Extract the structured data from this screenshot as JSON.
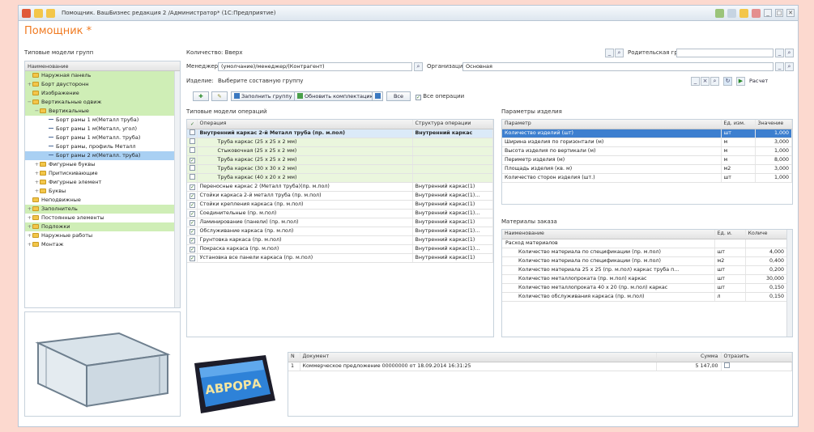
{
  "window": {
    "title": "Помощник. ВашБизнес редакция 2 /Администратор* (1С:Предприятие)",
    "page_title": "Помощник *",
    "controls": [
      "_",
      "□",
      "✕"
    ]
  },
  "left": {
    "filter_label": "Типовые модели групп",
    "tree_header": "Наименование",
    "tree": [
      {
        "label": "Наружная панель",
        "level": 1,
        "kind": "folder",
        "style": "green"
      },
      {
        "label": "Борт двусторонн",
        "level": 1,
        "kind": "folder",
        "style": "green",
        "toggle": "+"
      },
      {
        "label": "Изображение",
        "level": 1,
        "kind": "folder",
        "style": "green"
      },
      {
        "label": "Вертикальные одвиж",
        "level": 1,
        "kind": "folder",
        "style": "green",
        "toggle": "−"
      },
      {
        "label": "Вертикальные",
        "level": 2,
        "kind": "folder",
        "style": "green",
        "toggle": "−"
      },
      {
        "label": "Борт рамы 1 м(Металл труба)",
        "level": 3,
        "kind": "item",
        "style": ""
      },
      {
        "label": "Борт рамы 1 м(Металл, угол)",
        "level": 3,
        "kind": "item",
        "style": ""
      },
      {
        "label": "Борт рамы 1 м(Металл. труба)",
        "level": 3,
        "kind": "item",
        "style": ""
      },
      {
        "label": "Борт рамы, профиль Металл",
        "level": 3,
        "kind": "item",
        "style": ""
      },
      {
        "label": "Борт рамы 2 м(Металл. труба)",
        "level": 3,
        "kind": "item",
        "style": "sel"
      },
      {
        "label": "Фигурные буквы",
        "level": 2,
        "kind": "folder",
        "style": "",
        "toggle": "+"
      },
      {
        "label": "Притискивающие",
        "level": 2,
        "kind": "folder",
        "style": "",
        "toggle": "+"
      },
      {
        "label": "Фигурные элемент",
        "level": 2,
        "kind": "folder",
        "style": "",
        "toggle": "+"
      },
      {
        "label": "Буквы",
        "level": 2,
        "kind": "folder",
        "style": "",
        "toggle": "+"
      },
      {
        "label": "Неподвижные",
        "level": 1,
        "kind": "folder",
        "style": ""
      },
      {
        "label": "Заполнитель",
        "level": 1,
        "kind": "folder",
        "style": "green",
        "toggle": "+"
      },
      {
        "label": "Постоянные элементы",
        "level": 1,
        "kind": "folder",
        "style": "",
        "toggle": "+"
      },
      {
        "label": "Подложки",
        "level": 1,
        "kind": "folder",
        "style": "green",
        "toggle": "+"
      },
      {
        "label": "Наружные работы",
        "level": 1,
        "kind": "folder",
        "style": "",
        "toggle": "+"
      },
      {
        "label": "Монтаж",
        "level": 1,
        "kind": "folder",
        "style": "",
        "toggle": "+"
      }
    ]
  },
  "form": {
    "quantity_label": "Количество: Вверх",
    "manager_label": "Менеджер:",
    "manager_value": "(умолчание)/менеджер/(Контрагент)",
    "item_label": "Изделие:",
    "item_value": "Выберите составную группу",
    "parent_group_label": "Родительская группа:",
    "parent_group_value": "",
    "organization_label": "Организация:",
    "organization_value": "Основная",
    "calc_button": "Расчет",
    "toolbar_buttons": [
      "Заполнить группу",
      "Обновить комплектацию",
      "Все"
    ],
    "all_ops_checkbox": "Все операции"
  },
  "ops": {
    "section_label": "Типовые модели операций",
    "columns": [
      "Операция",
      "Структура операции"
    ],
    "rows": [
      {
        "check": "",
        "name": "Внутренний каркас 2-й Металл труба (пр. м.пол)",
        "struct": "Внутренний каркас",
        "indent": 1,
        "bold": true,
        "selected": true
      },
      {
        "check": "",
        "name": "Труба каркас (25 x 25 x 2 мм)",
        "struct": "",
        "indent": 2,
        "bold": false,
        "green": true
      },
      {
        "check": "",
        "name": "Стыковочная (25 x 25 x 2 мм)",
        "struct": "",
        "indent": 2,
        "bold": false,
        "green": true
      },
      {
        "check": "✓",
        "name": "Труба каркас (25 x 25 x 2 мм)",
        "struct": "",
        "indent": 2,
        "bold": false,
        "green": true
      },
      {
        "check": "",
        "name": "Труба каркас (30 x 30 x 2 мм)",
        "struct": "",
        "indent": 2,
        "bold": false,
        "green": true
      },
      {
        "check": "",
        "name": "Труба каркас (40 x 20 x 2 мм)",
        "struct": "",
        "indent": 2,
        "bold": false,
        "green": true
      },
      {
        "check": "✓",
        "name": "Переносные каркас 2 (Металл труба)(пр. м.пол)",
        "struct": "Внутренний каркас(1)",
        "indent": 1,
        "bold": false
      },
      {
        "check": "✓",
        "name": "Стойки каркаса 2-й металл труба (пр. м.пол)",
        "struct": "Внутренний каркас(1)...",
        "indent": 1,
        "bold": false
      },
      {
        "check": "✓",
        "name": "Стойки крепления каркаса (пр. м.пол)",
        "struct": "Внутренний каркас(1)",
        "indent": 1,
        "bold": false
      },
      {
        "check": "✓",
        "name": "Соединительные (пр. м.пол)",
        "struct": "Внутренний каркас(1)...",
        "indent": 1,
        "bold": false
      },
      {
        "check": "✓",
        "name": "Ламинирование (панели) (пр. м.пол)",
        "struct": "Внутренний каркас(1)",
        "indent": 1,
        "bold": false
      },
      {
        "check": "✓",
        "name": "Обслуживание каркаса (пр. м.пол)",
        "struct": "Внутренний каркас(1)...",
        "indent": 1,
        "bold": false
      },
      {
        "check": "✓",
        "name": "Грунтовка каркаса (пр. м.пол)",
        "struct": "Внутренний каркас(1)",
        "indent": 1,
        "bold": false
      },
      {
        "check": "✓",
        "name": "Покраска каркаса (пр. м.пол)",
        "struct": "Внутренний каркас(1)...",
        "indent": 1,
        "bold": false
      },
      {
        "check": "✓",
        "name": "Установка все панели каркаса (пр. м.пол)",
        "struct": "Внутренний каркас(1)",
        "indent": 1,
        "bold": false
      }
    ]
  },
  "params": {
    "section_label": "Параметры изделия",
    "columns": [
      "Параметр",
      "Ед. изм.",
      "Значение"
    ],
    "rows": [
      {
        "name": "Количество изделий (шт)",
        "unit": "шт",
        "value": "1,000",
        "selected": true
      },
      {
        "name": "Ширина изделия по горизонтали (м)",
        "unit": "м",
        "value": "3,000"
      },
      {
        "name": "Высота изделия по вертикали (м)",
        "unit": "м",
        "value": "1,000"
      },
      {
        "name": "Периметр изделия (м)",
        "unit": "м",
        "value": "8,000"
      },
      {
        "name": "Площадь изделия (кв. м)",
        "unit": "м2",
        "value": "3,000"
      },
      {
        "name": "Количество сторон изделия (шт.)",
        "unit": "шт",
        "value": "1,000"
      }
    ]
  },
  "materials": {
    "section_label": "Материалы заказа",
    "columns": [
      "Наименование",
      "Ед. и.",
      "Количе"
    ],
    "rows": [
      {
        "name": "Расход материалов",
        "unit": "",
        "value": "",
        "group": true
      },
      {
        "name": "Количество материала по спецификации (пр. м.пол)",
        "unit": "шт",
        "value": "4,000"
      },
      {
        "name": "Количество материала по спецификации (пр. м.пол)",
        "unit": "м2",
        "value": "0,400"
      },
      {
        "name": "Количество материала 25 x 25 (пр. м.пол) каркас труба п...",
        "unit": "шт",
        "value": "0,200"
      },
      {
        "name": "Количество металлопроката (пр. м.пол) каркас",
        "unit": "шт",
        "value": "30,000"
      },
      {
        "name": "Количество металлопроката 40 x 20 (пр. м.пол) каркас",
        "unit": "шт",
        "value": "0,150"
      },
      {
        "name": "Количество обслуживания каркаса (пр. м.пол)",
        "unit": "л",
        "value": "0,150"
      }
    ]
  },
  "docs": {
    "columns": [
      "N",
      "Документ",
      "Сумма",
      "Отразить"
    ],
    "rows": [
      {
        "n": "1",
        "doc": "Коммерческое предложение 00000000 от 18.09.2014 16:31:25",
        "sum": "5 147,00",
        "check": ""
      }
    ]
  },
  "preview_sign_text": "АВРОРА"
}
